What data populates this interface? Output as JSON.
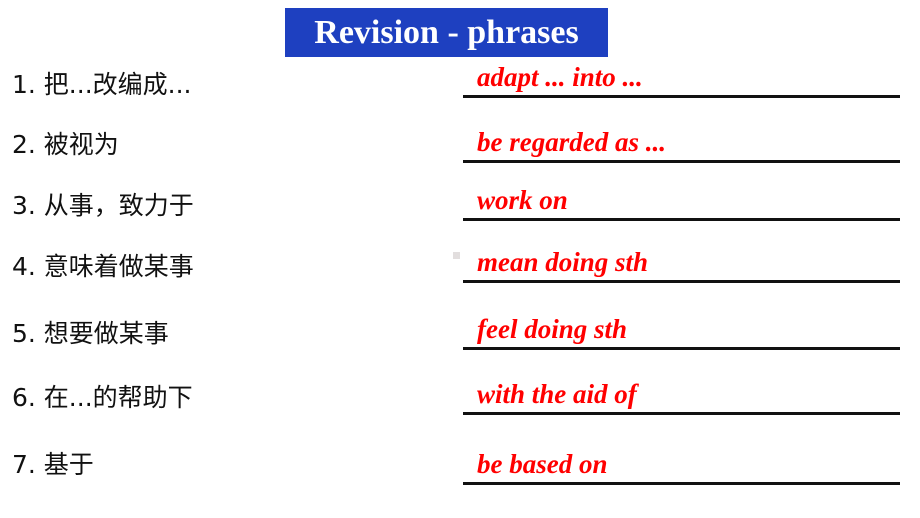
{
  "slide": {
    "title": "Revision - phrases",
    "title_bg_color": "#1E40C0",
    "title_text_color": "#FFFFFF",
    "answer_color": "#FF0000",
    "background_color": "#FFFFFF"
  },
  "items": [
    {
      "number": "1.",
      "prompt": "1. 把...改编成...",
      "answer": "adapt ... into ..."
    },
    {
      "number": "2.",
      "prompt": "2. 被视为",
      "answer": "be regarded as ..."
    },
    {
      "number": "3.",
      "prompt": "3. 从事，致力于",
      "answer": "work on"
    },
    {
      "number": "4.",
      "prompt": "4. 意味着做某事",
      "answer": "mean doing sth"
    },
    {
      "number": "5.",
      "prompt": "5. 想要做某事",
      "answer": "feel doing sth"
    },
    {
      "number": "6.",
      "prompt": "6. 在...的帮助下",
      "answer": "with the aid of"
    },
    {
      "number": "7.",
      "prompt": "7. 基于",
      "answer": "be based on"
    }
  ]
}
